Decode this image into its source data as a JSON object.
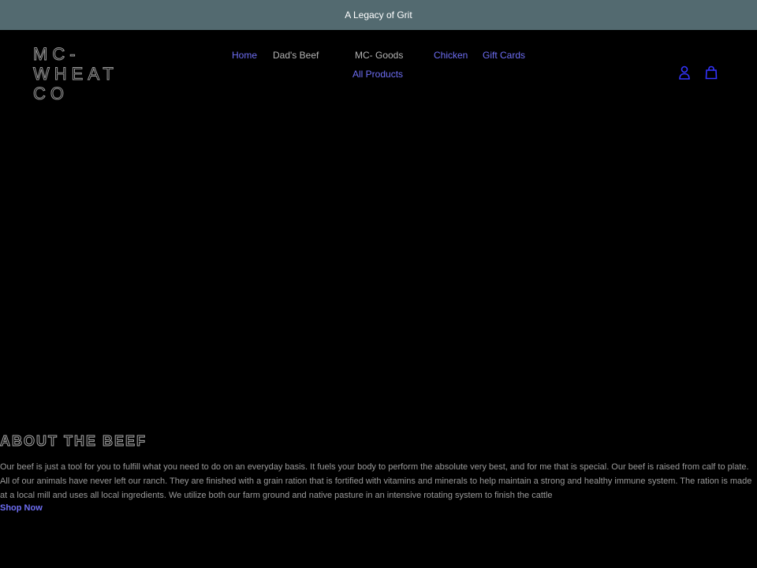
{
  "announcement": {
    "text": "A Legacy of Grit"
  },
  "header": {
    "logo_text": "MC-WHEAT CO",
    "nav": {
      "home": "Home",
      "dads_beef": "Dad's Beef",
      "mc_goods": "MC- Goods",
      "chicken": "Chicken",
      "gift_cards": "Gift Cards",
      "all_products": "All Products"
    },
    "icons": {
      "account": "account-icon",
      "cart": "cart-icon"
    }
  },
  "about": {
    "title": "ABOUT THE BEEF",
    "body": "Our beef is just a tool for you to fulfill what you need to do on an everyday basis. It fuels your body to perform the absolute very best, and for me that is special. Our beef is raised from calf to plate. All of our animals have never left our ranch. They are finished with a grain ration that is fortified with vitamins and minerals to help maintain a strong and healthy immune system. The ration is made at a local mill and uses all local ingredients. We utilize both our farm ground and native pasture in an intensive rotating system to finish the cattle",
    "cta": "Shop Now"
  },
  "colors": {
    "announcement_bg": "#536a70",
    "page_bg": "#000000",
    "link": "#6e6ef4",
    "muted_text": "#9a9a9a"
  }
}
